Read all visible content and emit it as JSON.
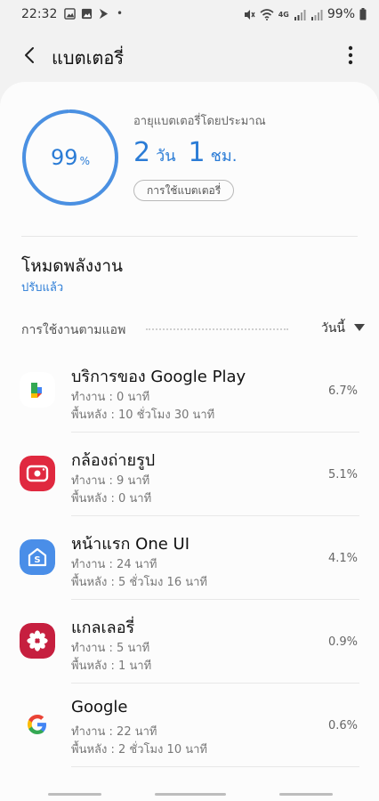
{
  "status_bar": {
    "time": "22:32",
    "battery_percent": "99%",
    "network": "4G"
  },
  "app_bar": {
    "title": "แบตเตอรี่"
  },
  "battery": {
    "level_number": "99",
    "level_unit": "%",
    "level_fraction": 0.99,
    "estimate_label": "อายุแบตเตอรี่โดยประมาณ",
    "estimate_days": "2",
    "estimate_days_unit": "วัน",
    "estimate_hours": "1",
    "estimate_hours_unit": "ชม.",
    "usage_button": "การใช้แบตเตอรี่",
    "ring_color": "#4a90e2"
  },
  "power_mode": {
    "title": "โหมดพลังงาน",
    "value": "ปรับแล้ว"
  },
  "app_usage": {
    "label": "การใช้งานตามแอพ",
    "filter": "วันนี้",
    "apps": [
      {
        "name": "บริการของ Google Play",
        "active": "ทำงาน : 0 นาที",
        "background": "พื้นหลัง : 10 ชั่วโมง 30 นาที",
        "percent": "6.7%",
        "icon": "google-play-services-icon"
      },
      {
        "name": "กล้องถ่ายรูป",
        "active": "ทำงาน : 9 นาที",
        "background": "พื้นหลัง : 0 นาที",
        "percent": "5.1%",
        "icon": "camera-icon"
      },
      {
        "name": "หน้าแรก One UI",
        "active": "ทำงาน : 24 นาที",
        "background": "พื้นหลัง : 5 ชั่วโมง 16 นาที",
        "percent": "4.1%",
        "icon": "one-ui-home-icon"
      },
      {
        "name": "แกลเลอรี่",
        "active": "ทำงาน : 5 นาที",
        "background": "พื้นหลัง : 1 นาที",
        "percent": "0.9%",
        "icon": "gallery-icon"
      },
      {
        "name": "Google",
        "active": "ทำงาน : 22 นาที",
        "background": "พื้นหลัง : 2 ชั่วโมง 10 นาที",
        "percent": "0.6%",
        "icon": "google-icon"
      }
    ]
  }
}
